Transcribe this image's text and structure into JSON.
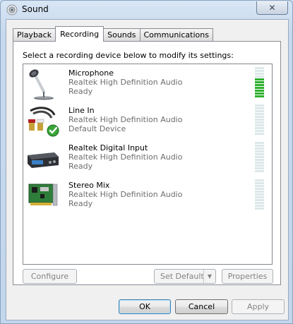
{
  "window": {
    "title": "Sound",
    "close_glyph": "✕"
  },
  "tabs": [
    {
      "label": "Playback",
      "active": false
    },
    {
      "label": "Recording",
      "active": true
    },
    {
      "label": "Sounds",
      "active": false
    },
    {
      "label": "Communications",
      "active": false
    }
  ],
  "instruction": "Select a recording device below to modify its settings:",
  "devices": [
    {
      "name": "Microphone",
      "driver": "Realtek High Definition Audio",
      "status": "Ready",
      "icon": "microphone-icon",
      "level": 0.6
    },
    {
      "name": "Line In",
      "driver": "Realtek High Definition Audio",
      "status": "Default Device",
      "icon": "line-in-icon",
      "level": 0
    },
    {
      "name": "Realtek Digital Input",
      "driver": "Realtek High Definition Audio",
      "status": "Ready",
      "icon": "digital-input-icon",
      "level": 0
    },
    {
      "name": "Stereo Mix",
      "driver": "Realtek High Definition Audio",
      "status": "Ready",
      "icon": "sound-card-icon",
      "level": 0
    }
  ],
  "buttons": {
    "configure": "Configure",
    "set_default": "Set Default",
    "properties": "Properties",
    "ok": "OK",
    "cancel": "Cancel",
    "apply": "Apply"
  },
  "colors": {
    "meter_on": "#2fb12f",
    "meter_off": "#dde8e8"
  }
}
